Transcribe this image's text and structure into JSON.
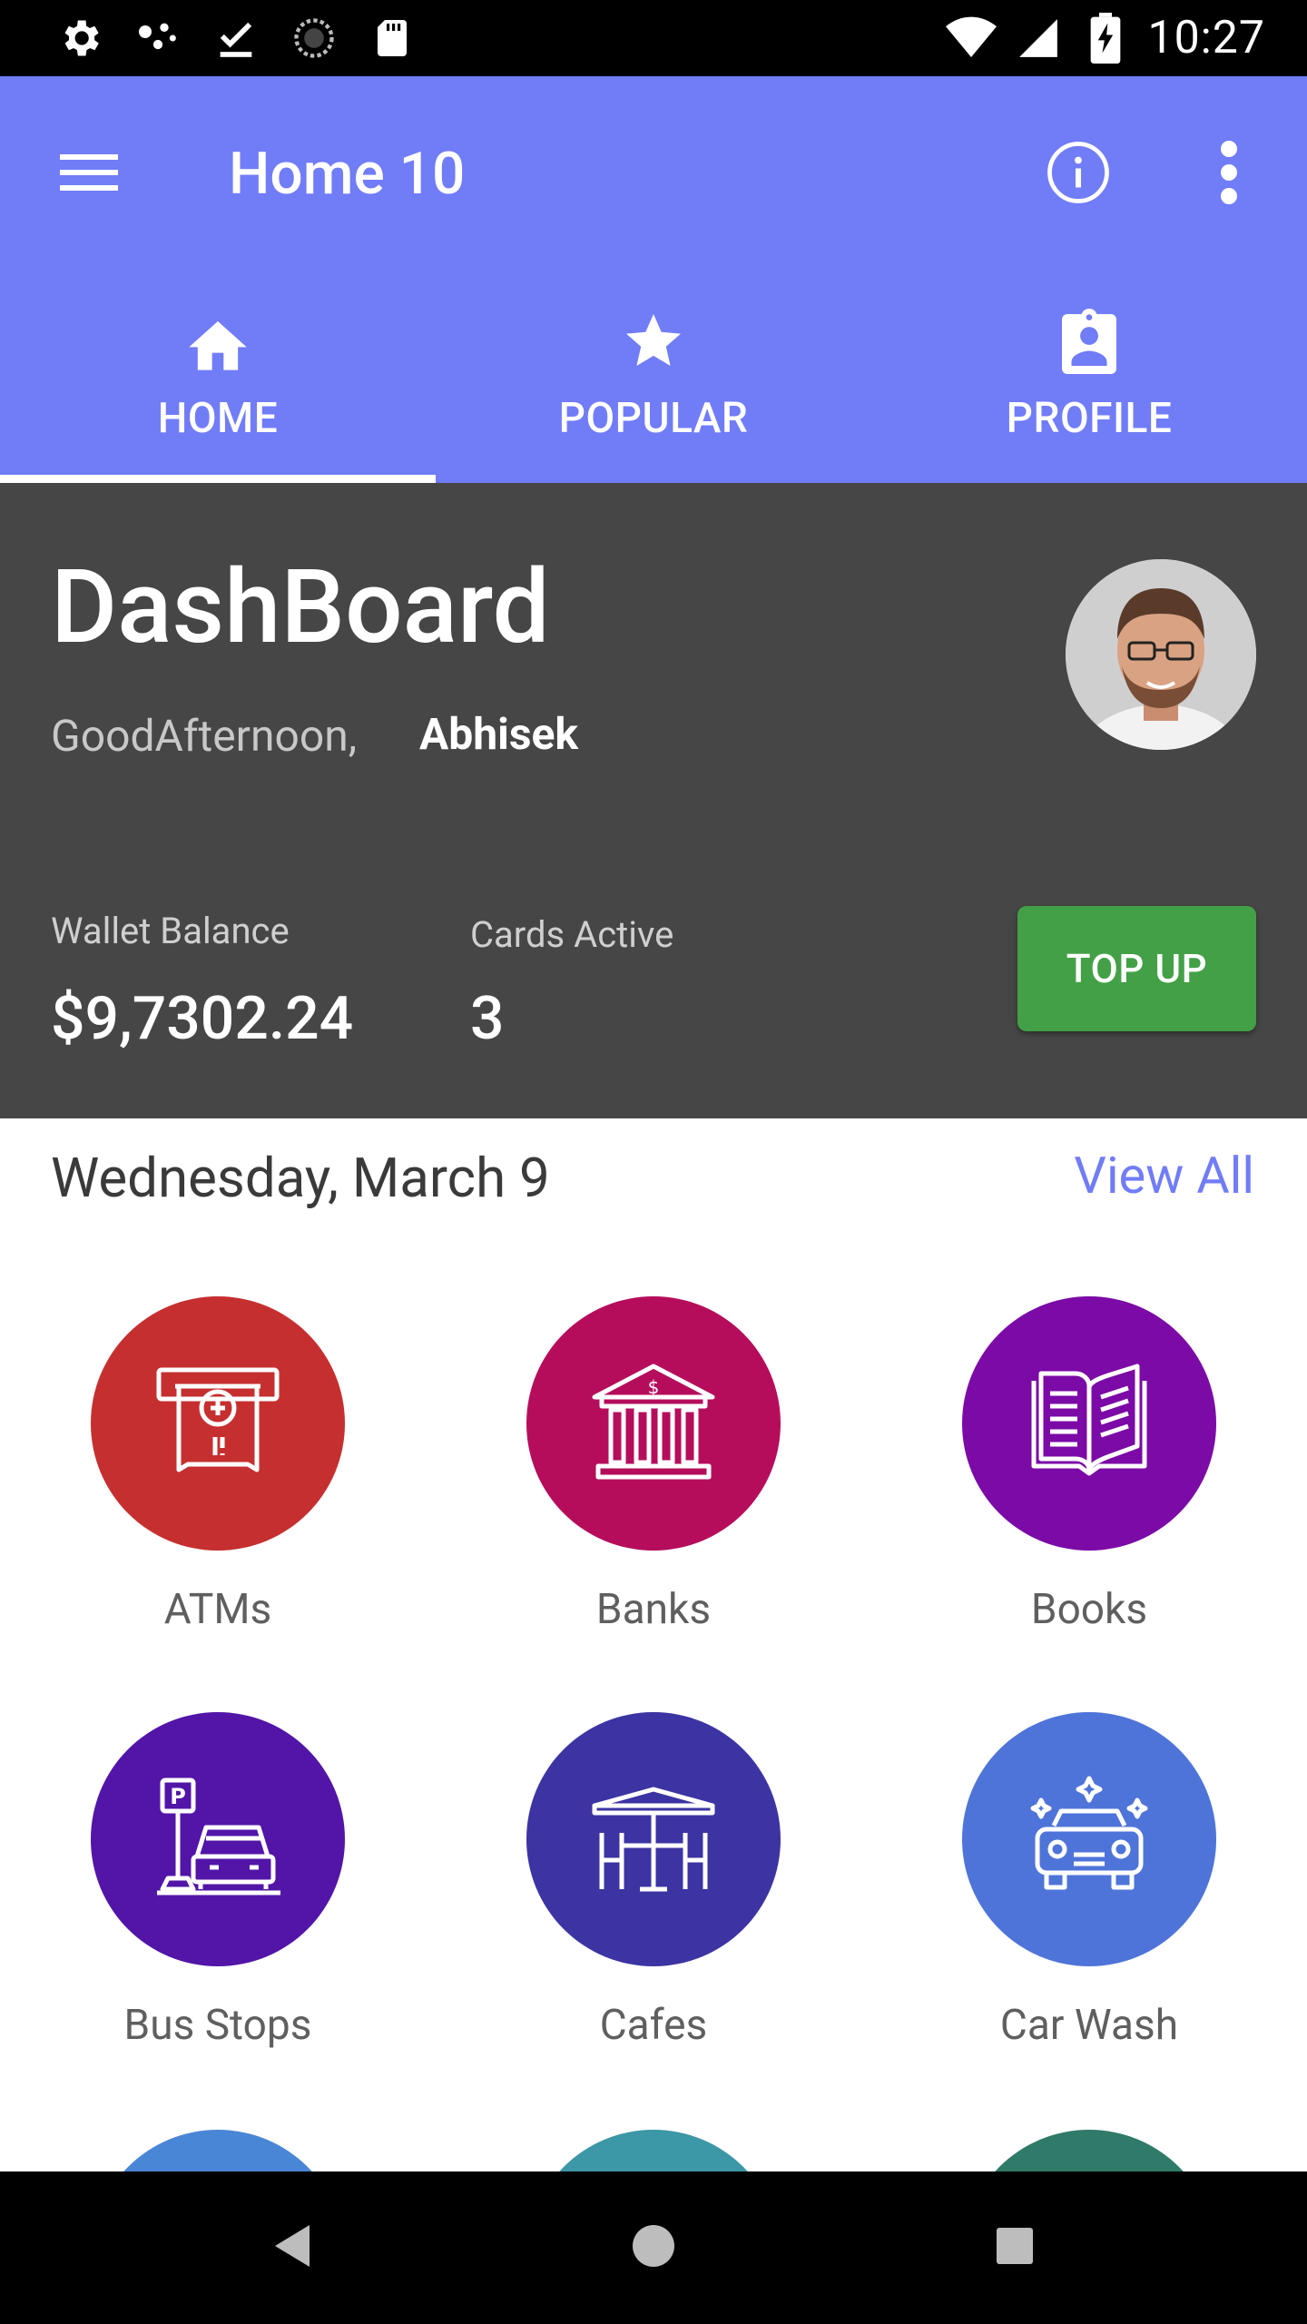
{
  "status_bar": {
    "time": "10:27",
    "left_icons": [
      "gear-icon",
      "dots-icon",
      "download-done-icon",
      "sync-icon",
      "sd-card-icon"
    ],
    "right_icons": [
      "wifi-icon",
      "signal-icon",
      "battery-charging-icon"
    ]
  },
  "app_bar": {
    "title": "Home 10",
    "color": "#717cf7"
  },
  "tabs": [
    {
      "label": "HOME",
      "icon": "home-icon",
      "selected": true
    },
    {
      "label": "POPULAR",
      "icon": "star-icon",
      "selected": false
    },
    {
      "label": "PROFILE",
      "icon": "profile-badge-icon",
      "selected": false
    }
  ],
  "dashboard": {
    "title": "DashBoard",
    "greeting": "GoodAfternoon,",
    "username": "Abhisek",
    "wallet_label": "Wallet Balance",
    "wallet_value": "$9,7302.24",
    "cards_label": "Cards Active",
    "cards_value": "3",
    "topup_label": "TOP UP"
  },
  "date_row": {
    "date": "Wednesday, March 9",
    "view_all": "View All"
  },
  "categories": [
    {
      "label": "ATMs",
      "icon": "atm-icon",
      "color": "#c62f2f"
    },
    {
      "label": "Banks",
      "icon": "bank-icon",
      "color": "#b50d5c"
    },
    {
      "label": "Books",
      "icon": "book-icon",
      "color": "#7b0aa6"
    },
    {
      "label": "Bus Stops",
      "icon": "parking-icon",
      "color": "#5215a8"
    },
    {
      "label": "Cafes",
      "icon": "cafe-icon",
      "color": "#3c34a3"
    },
    {
      "label": "Car Wash",
      "icon": "car-wash-icon",
      "color": "#4f74d9"
    }
  ],
  "partial_row_colors": [
    "#4a86d6",
    "#3c97a6",
    "#2f7a68"
  ]
}
